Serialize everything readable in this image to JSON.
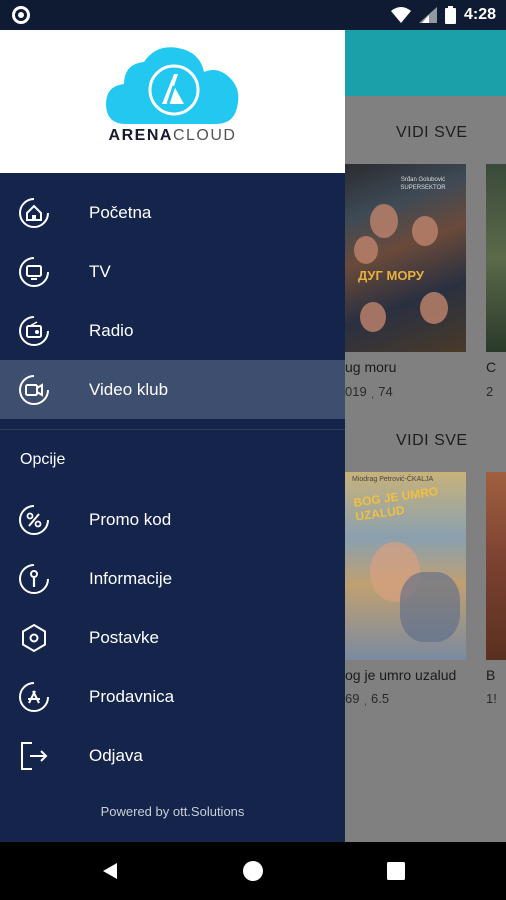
{
  "status_bar": {
    "time": "4:28"
  },
  "brand": {
    "name_bold": "ARENA",
    "name_light": "CLOUD",
    "cloud_color": "#22c8f0"
  },
  "menu": {
    "items": [
      {
        "label": "Početna",
        "icon": "home-icon"
      },
      {
        "label": "TV",
        "icon": "tv-icon"
      },
      {
        "label": "Radio",
        "icon": "radio-icon"
      },
      {
        "label": "Video klub",
        "icon": "video-camera-icon",
        "active": true
      }
    ],
    "options_title": "Opcije",
    "options": [
      {
        "label": "Promo kod",
        "icon": "percent-icon"
      },
      {
        "label": "Informacije",
        "icon": "info-icon"
      },
      {
        "label": "Postavke",
        "icon": "settings-hexagon-icon"
      },
      {
        "label": "Prodavnica",
        "icon": "app-store-icon"
      },
      {
        "label": "Odjava",
        "icon": "logout-icon"
      }
    ],
    "footer": "Powered by ott.Solutions"
  },
  "background": {
    "see_all_1": "VIDI SVE",
    "see_all_2": "VIDI SVE",
    "card1": {
      "title": "ug moru",
      "meta": "019 ˌ 74",
      "poster_title": "ДУГ МОРУ",
      "poster_top": "Srđan Golubović\nSUPERSEKTOR"
    },
    "card2": {
      "title": "og je umro uzalud",
      "meta": "69 ˌ 6.5",
      "poster_title": "BOG JE UMRO UZALUD",
      "poster_top": "Miodrag Petrović-ČKALJA"
    },
    "card3": {
      "title_fragment": "C",
      "meta_fragment": "2"
    },
    "card4": {
      "title_fragment": "B",
      "meta_fragment": "1!"
    }
  },
  "colors": {
    "drawer_bg": "#14244a",
    "active_bg": "#3d4e6e",
    "header_accent": "#1aa0a8"
  }
}
